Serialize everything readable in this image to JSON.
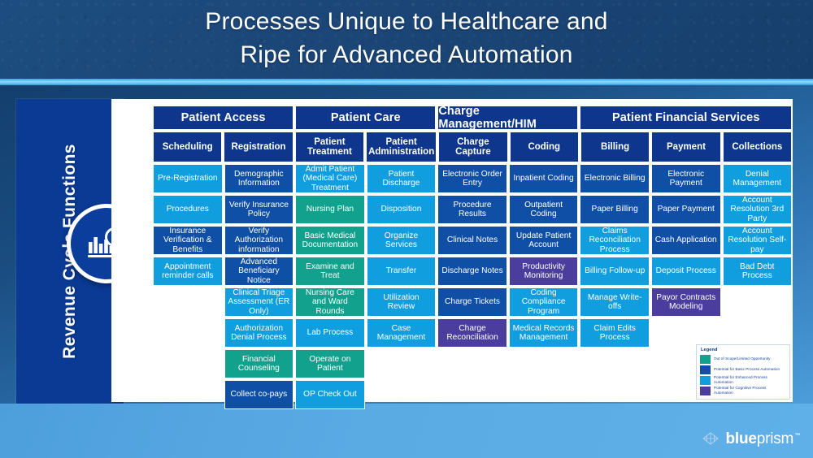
{
  "slide": {
    "title_line1": "Processes Unique to Healthcare and",
    "title_line2": "Ripe for Advanced Automation",
    "sidebar_label": "Revenue Cycle Functions",
    "sidebar_icon": "revenue-analysis-icon"
  },
  "colors": {
    "out_of_scope": "#12a18c",
    "basic": "#104fa6",
    "enhanced": "#109ede",
    "cognitive": "#4b3d9e",
    "header": "#0d368c",
    "sidebar": "#0a3a94"
  },
  "groups": [
    {
      "label": "Patient Access",
      "span": 2
    },
    {
      "label": "Patient Care",
      "span": 2
    },
    {
      "label": "Charge Management/HIM",
      "span": 2
    },
    {
      "label": "Patient Financial Services",
      "span": 3
    }
  ],
  "subheaders": [
    "Scheduling",
    "Registration",
    "Patient Treatment",
    "Patient Administration",
    "Charge Capture",
    "Coding",
    "Billing",
    "Payment",
    "Collections"
  ],
  "columns": [
    {
      "header": "Scheduling",
      "cells": [
        {
          "label": "Pre-Registration",
          "type": "enhanced"
        },
        {
          "label": "Procedures",
          "type": "enhanced"
        },
        {
          "label": "Insurance Verification & Benefits",
          "type": "basic"
        },
        {
          "label": "Appointment reminder calls",
          "type": "enhanced"
        }
      ]
    },
    {
      "header": "Registration",
      "cells": [
        {
          "label": "Demographic Information",
          "type": "basic"
        },
        {
          "label": "Verify Insurance Policy",
          "type": "basic"
        },
        {
          "label": "Verify Authorization information",
          "type": "basic"
        },
        {
          "label": "Advanced Beneficiary Notice",
          "type": "basic"
        },
        {
          "label": "Clinical Triage Assessment (ER Only)",
          "type": "enhanced"
        },
        {
          "label": "Authorization Denial Process",
          "type": "enhanced"
        },
        {
          "label": "Financial Counseling",
          "type": "out_of_scope"
        },
        {
          "label": "Collect co-pays",
          "type": "basic"
        }
      ]
    },
    {
      "header": "Patient Treatment",
      "cells": [
        {
          "label": "Admit Patient (Medical Care) Treatment",
          "type": "enhanced"
        },
        {
          "label": "Nursing Plan",
          "type": "out_of_scope"
        },
        {
          "label": "Basic Medical Documentation",
          "type": "out_of_scope"
        },
        {
          "label": "Examine and Treat",
          "type": "out_of_scope"
        },
        {
          "label": "Nursing Care and Ward Rounds",
          "type": "out_of_scope"
        },
        {
          "label": "Lab Process",
          "type": "enhanced"
        },
        {
          "label": "Operate on Patient",
          "type": "out_of_scope"
        },
        {
          "label": "OP Check Out",
          "type": "enhanced"
        }
      ]
    },
    {
      "header": "Patient Administration",
      "cells": [
        {
          "label": "Patient Discharge",
          "type": "enhanced"
        },
        {
          "label": "Disposition",
          "type": "enhanced"
        },
        {
          "label": "Organize Services",
          "type": "enhanced"
        },
        {
          "label": "Transfer",
          "type": "enhanced"
        },
        {
          "label": "Utilization Review",
          "type": "enhanced"
        },
        {
          "label": "Case Management",
          "type": "enhanced"
        }
      ]
    },
    {
      "header": "Charge Capture",
      "cells": [
        {
          "label": "Electronic Order Entry",
          "type": "basic"
        },
        {
          "label": "Procedure Results",
          "type": "basic"
        },
        {
          "label": "Clinical Notes",
          "type": "basic"
        },
        {
          "label": "Discharge Notes",
          "type": "basic"
        },
        {
          "label": "Charge Tickets",
          "type": "basic"
        },
        {
          "label": "Charge Reconciliation",
          "type": "cognitive"
        }
      ]
    },
    {
      "header": "Coding",
      "cells": [
        {
          "label": "Inpatient Coding",
          "type": "basic"
        },
        {
          "label": "Outpatient Coding",
          "type": "basic"
        },
        {
          "label": "Update Patient Account",
          "type": "basic"
        },
        {
          "label": "Productivity Monitoring",
          "type": "cognitive"
        },
        {
          "label": "Coding Compliance Program",
          "type": "enhanced"
        },
        {
          "label": "Medical Records Management",
          "type": "enhanced"
        }
      ]
    },
    {
      "header": "Billing",
      "cells": [
        {
          "label": "Electronic Billing",
          "type": "basic"
        },
        {
          "label": "Paper Billing",
          "type": "basic"
        },
        {
          "label": "Claims Reconciliation Process",
          "type": "enhanced"
        },
        {
          "label": "Billing Follow-up",
          "type": "enhanced"
        },
        {
          "label": "Manage Write-offs",
          "type": "enhanced"
        },
        {
          "label": "Claim Edits Process",
          "type": "enhanced"
        }
      ]
    },
    {
      "header": "Payment",
      "cells": [
        {
          "label": "Electronic Payment",
          "type": "basic"
        },
        {
          "label": "Paper Payment",
          "type": "basic"
        },
        {
          "label": "Cash Application",
          "type": "basic"
        },
        {
          "label": "Deposit Process",
          "type": "enhanced"
        },
        {
          "label": "Payor Contracts Modeling",
          "type": "cognitive"
        }
      ]
    },
    {
      "header": "Collections",
      "cells": [
        {
          "label": "Denial Management",
          "type": "enhanced"
        },
        {
          "label": "Account Resolution 3rd Party",
          "type": "enhanced"
        },
        {
          "label": "Account Resolution Self-pay",
          "type": "enhanced"
        },
        {
          "label": "Bad Debt Process",
          "type": "enhanced"
        }
      ]
    }
  ],
  "legend": {
    "title": "Legend",
    "items": [
      {
        "label": "Out of Scope/Limited Opportunity",
        "type": "out_of_scope"
      },
      {
        "label": "Potential for Basic Process Automation",
        "type": "basic"
      },
      {
        "label": "Potential for Enhanced Process Automation",
        "type": "enhanced"
      },
      {
        "label": "Potential for Cognitive Process Automation",
        "type": "cognitive"
      }
    ]
  },
  "footer": {
    "logo_blue": "blue",
    "logo_prism": "prism",
    "logo_tm": "™",
    "logo_mark": "blueprism-pyramid-icon"
  }
}
